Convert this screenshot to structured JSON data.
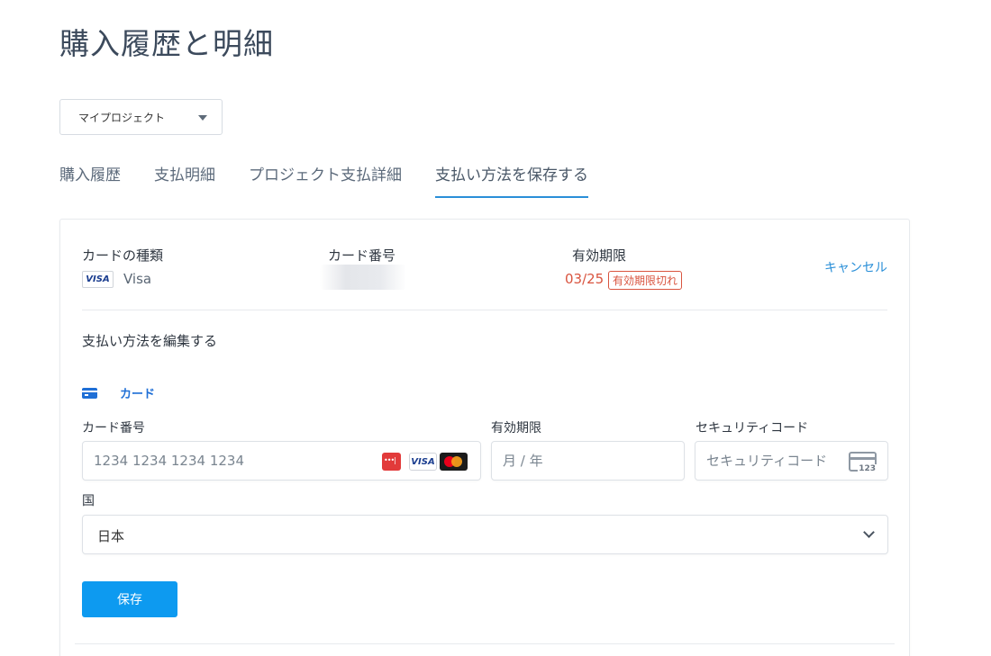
{
  "page": {
    "title": "購入履歴と明細"
  },
  "project_select": {
    "value": "マイプロジェクト"
  },
  "tabs": [
    {
      "label": "購入履歴",
      "active": false
    },
    {
      "label": "支払明細",
      "active": false
    },
    {
      "label": "プロジェクト支払詳細",
      "active": false
    },
    {
      "label": "支払い方法を保存する",
      "active": true
    }
  ],
  "saved_card": {
    "type_label": "カードの種類",
    "brand_badge": "VISA",
    "brand": "Visa",
    "number_label": "カード番号",
    "expiry_label": "有効期限",
    "expiry_value": "03/25",
    "expired_badge": "有効期限切れ",
    "cancel": "キャンセル"
  },
  "edit": {
    "heading": "支払い方法を編集する",
    "method_tab": "カード",
    "card_number_label": "カード番号",
    "card_number_placeholder": "1234 1234 1234 1234",
    "expiry_label": "有効期限",
    "expiry_placeholder": "月 / 年",
    "cvc_label": "セキュリティコード",
    "cvc_placeholder": "セキュリティコード",
    "cvc_icon_text": "123",
    "brand_visa": "VISA",
    "country_label": "国",
    "country_value": "日本",
    "save": "保存"
  },
  "icons": {
    "card_tab": "credit-card-icon",
    "cvc": "cvc-card-icon",
    "brands": [
      "generic-card-icon",
      "visa-icon",
      "mastercard-icon"
    ]
  },
  "colors": {
    "accent": "#2a8fd8",
    "primary_button": "#0d9af0",
    "error": "#d9543f",
    "card_tab": "#1f6fd6"
  }
}
